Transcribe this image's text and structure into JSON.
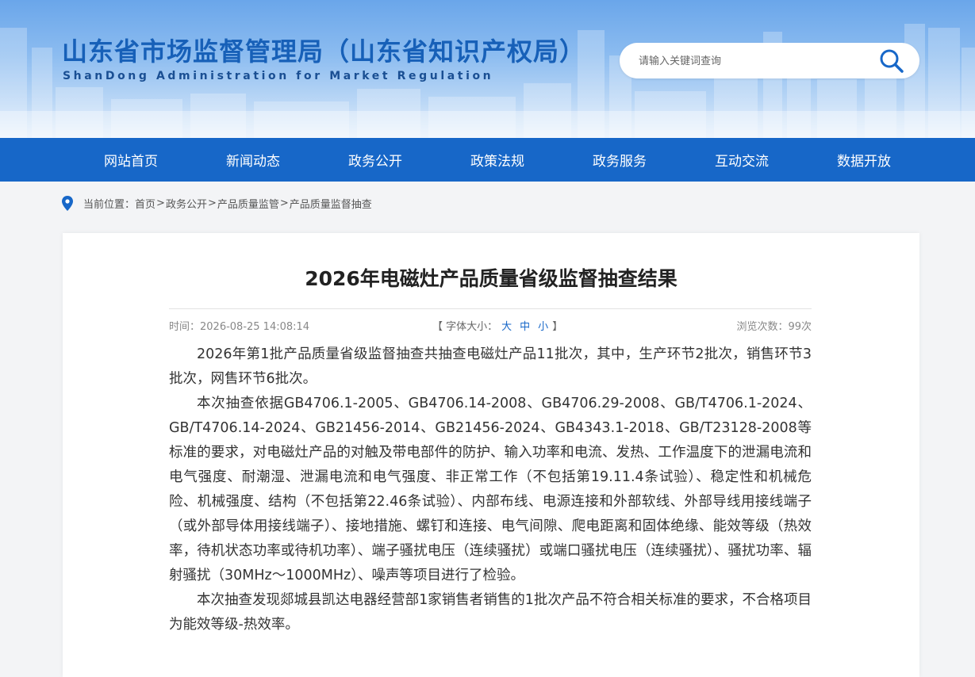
{
  "site": {
    "title_cn": "山东省市场监督管理局（山东省知识产权局）",
    "title_en": "ShanDong Administration for Market Regulation"
  },
  "search": {
    "placeholder": "请输入关键词查询",
    "icon": "search-icon"
  },
  "nav": [
    {
      "label": "网站首页"
    },
    {
      "label": "新闻动态"
    },
    {
      "label": "政务公开"
    },
    {
      "label": "政策法规"
    },
    {
      "label": "政务服务"
    },
    {
      "label": "互动交流"
    },
    {
      "label": "数据开放"
    }
  ],
  "breadcrumb": {
    "prefix": "当前位置：",
    "items": [
      "首页",
      "政务公开",
      "产品质量监管",
      "产品质量监督抽查"
    ],
    "separator": ">"
  },
  "article": {
    "title": "2026年电磁灶产品质量省级监督抽查结果",
    "time": "时间：2026-08-25 14:08:14",
    "font_label": "【 字体大小：",
    "font_sizes": [
      "大",
      "中",
      "小"
    ],
    "font_end": "】",
    "views": "浏览次数：99次",
    "paragraphs": [
      "2026年第1批产品质量省级监督抽查共抽查电磁灶产品11批次，其中，生产环节2批次，销售环节3批次，网售环节6批次。",
      "本次抽查依据GB4706.1-2005、GB4706.14-2008、GB4706.29-2008、GB/T4706.1-2024、GB/T4706.14-2024、GB21456-2014、GB21456-2024、GB4343.1-2018、GB/T23128-2008等标准的要求，对电磁灶产品的对触及带电部件的防护、输入功率和电流、发热、工作温度下的泄漏电流和电气强度、耐潮湿、泄漏电流和电气强度、非正常工作（不包括第19.11.4条试验）、稳定性和机械危险、机械强度、结构（不包括第22.46条试验）、内部布线、电源连接和外部软线、外部导线用接线端子（或外部导体用接线端子）、接地措施、螺钉和连接、电气间隙、爬电距离和固体绝缘、能效等级（热效率，待机状态功率或待机功率）、端子骚扰电压（连续骚扰）或端口骚扰电压（连续骚扰）、骚扰功率、辐射骚扰（30MHz～1000MHz）、噪声等项目进行了检验。",
      "本次抽查发现郯城县凯达电器经营部1家销售者销售的1批次产品不符合相关标准的要求，不合格项目为能效等级-热效率。"
    ]
  },
  "colors": {
    "brand_blue": "#1767c8",
    "title_blue": "#1760b8",
    "page_bg": "#f3f4f6"
  }
}
